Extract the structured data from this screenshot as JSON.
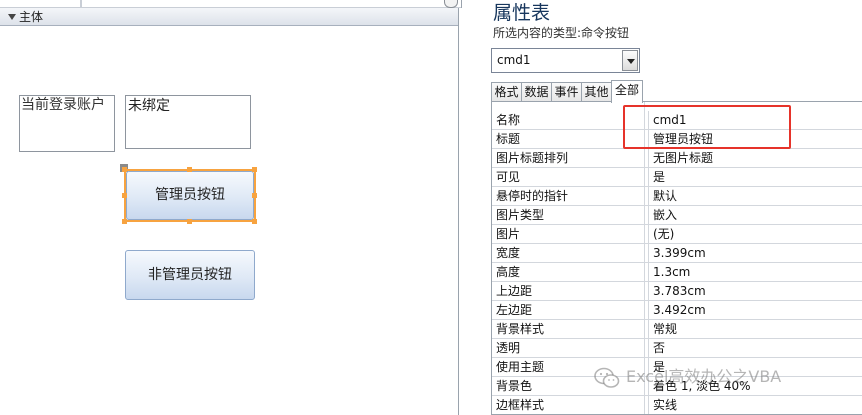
{
  "design": {
    "section_label": "主体",
    "label_text": "当前登录账户",
    "textbox_text": "未绑定",
    "cmd1_caption": "管理员按钮",
    "cmd2_caption": "非管理员按钮"
  },
  "props": {
    "title": "属性表",
    "selection_type_label": "所选内容的类型:",
    "selection_type_value": "命令按钮",
    "combo_value": "cmd1",
    "tabs": [
      "格式",
      "数据",
      "事件",
      "其他",
      "全部"
    ],
    "active_tab": "全部",
    "rows": [
      {
        "k": "名称",
        "v": "cmd1"
      },
      {
        "k": "标题",
        "v": "管理员按钮"
      },
      {
        "k": "图片标题排列",
        "v": "无图片标题"
      },
      {
        "k": "可见",
        "v": "是"
      },
      {
        "k": "悬停时的指针",
        "v": "默认"
      },
      {
        "k": "图片类型",
        "v": "嵌入"
      },
      {
        "k": "图片",
        "v": "(无)"
      },
      {
        "k": "宽度",
        "v": "3.399cm"
      },
      {
        "k": "高度",
        "v": "1.3cm"
      },
      {
        "k": "上边距",
        "v": "3.783cm"
      },
      {
        "k": "左边距",
        "v": "3.492cm"
      },
      {
        "k": "背景样式",
        "v": "常规"
      },
      {
        "k": "透明",
        "v": "否"
      },
      {
        "k": "使用主题",
        "v": "是"
      },
      {
        "k": "背景色",
        "v": "着色 1, 淡色 40%"
      },
      {
        "k": "边框样式",
        "v": "实线"
      }
    ]
  },
  "watermark": "Excel高效办公之VBA",
  "colors": {
    "title": "#17365d",
    "selection": "#f7a340",
    "highlight": "#e6332a",
    "button_border": "#8fa9cc"
  }
}
